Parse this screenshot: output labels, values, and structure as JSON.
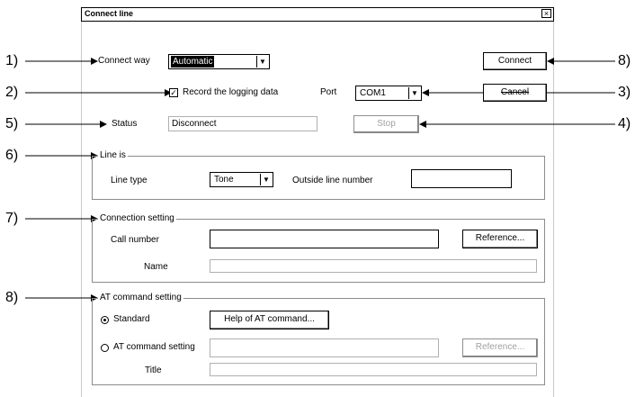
{
  "window": {
    "title": "Connect line",
    "close_glyph": "×"
  },
  "callouts": {
    "c1": "1)",
    "c2": "2)",
    "c5": "5)",
    "c6": "6)",
    "c7": "7)",
    "c8a": "8)",
    "c8b": "8)",
    "c3": "3)",
    "c4": "4)"
  },
  "connect_way": {
    "label": "Connect way",
    "value": "Automatic"
  },
  "record": {
    "label": "Record the logging data",
    "checked": true,
    "check_glyph": "✓"
  },
  "port": {
    "label": "Port",
    "value": "COM1"
  },
  "status": {
    "label": "Status",
    "value": "Disconnect"
  },
  "buttons": {
    "connect": "Connect",
    "cancel": "Cancel",
    "stop": "Stop"
  },
  "line_is": {
    "title": "Line is",
    "line_type_label": "Line type",
    "line_type_value": "Tone",
    "outside_label": "Outside line number",
    "outside_value": ""
  },
  "connection_setting": {
    "title": "Connection setting",
    "call_number_label": "Call number",
    "call_number_value": "",
    "reference_label": "Reference...",
    "name_label": "Name",
    "name_value": ""
  },
  "at_command": {
    "title": "AT command setting",
    "standard_label": "Standard",
    "help_button": "Help of AT command...",
    "at_setting_label": "AT command setting",
    "at_value": "",
    "reference_label": "Reference...",
    "title_label": "Title",
    "title_value": "",
    "selected": "Standard"
  },
  "icons": {
    "dropdown": "dropdown-arrow-icon"
  }
}
